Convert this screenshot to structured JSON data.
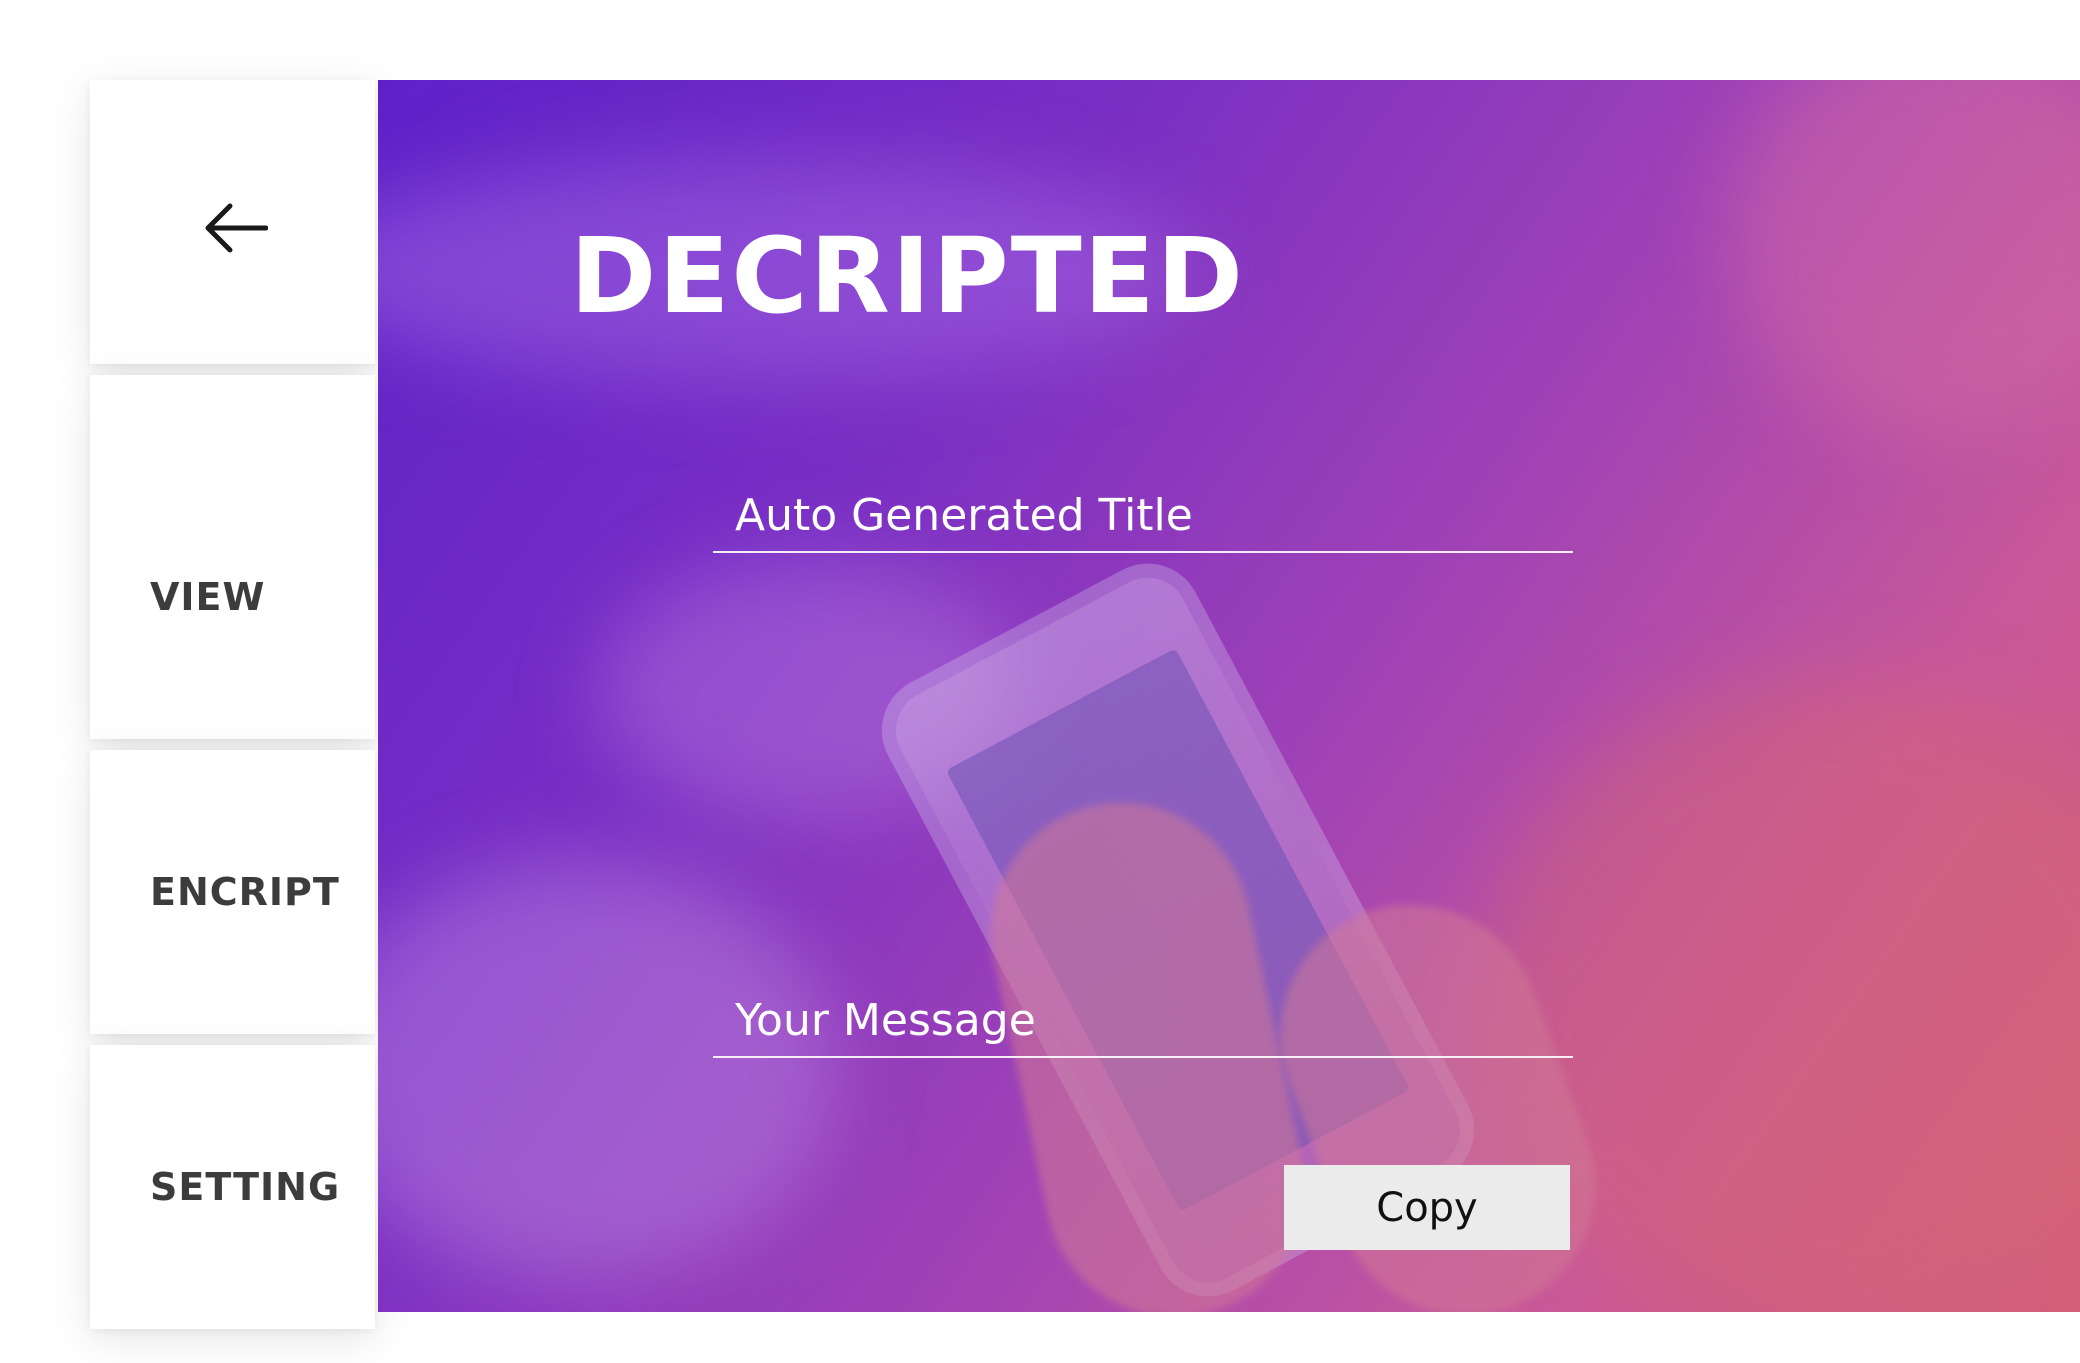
{
  "sidebar": {
    "back_icon": "arrow-left-icon",
    "items": [
      {
        "label": "VIEW"
      },
      {
        "label": "ENCRIPT"
      },
      {
        "label": "SETTING"
      }
    ]
  },
  "main": {
    "title": "DECRIPTED",
    "title_field": {
      "placeholder": "Auto Generated Title"
    },
    "message_field": {
      "placeholder": "Your Message"
    },
    "copy_label": "Copy"
  },
  "colors": {
    "gradient_start": "#5e21c9",
    "gradient_end": "#d45f78",
    "nav_text": "#3c3c3c",
    "button_bg": "#ebebeb"
  }
}
